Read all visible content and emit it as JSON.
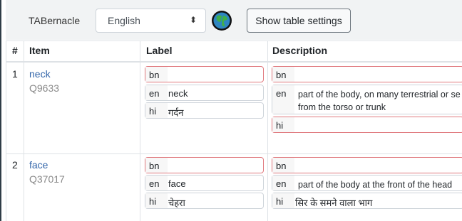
{
  "toolbar": {
    "app_name": "TABernacle",
    "language_select": {
      "value": "English",
      "arrows": "⬍"
    },
    "globe_icon": "globe-icon",
    "show_settings_label": "Show table settings"
  },
  "table": {
    "headers": {
      "num": "#",
      "item": "Item",
      "label": "Label",
      "description": "Description"
    },
    "rows": [
      {
        "num": "1",
        "item_label": "neck",
        "item_id": "Q9633",
        "labels": [
          {
            "lang": "bn",
            "text": ""
          },
          {
            "lang": "en",
            "text": "neck"
          },
          {
            "lang": "hi",
            "text": "गर्दन"
          }
        ],
        "descriptions": [
          {
            "lang": "bn",
            "text": ""
          },
          {
            "lang": "en",
            "line1": "part of the body, on many terrestrial or se",
            "line2": "from the torso or trunk"
          },
          {
            "lang": "hi",
            "text": ""
          }
        ]
      },
      {
        "num": "2",
        "item_label": "face",
        "item_id": "Q37017",
        "labels": [
          {
            "lang": "bn",
            "text": ""
          },
          {
            "lang": "en",
            "text": "face"
          },
          {
            "lang": "hi",
            "text": "चेहरा"
          }
        ],
        "descriptions": [
          {
            "lang": "bn",
            "text": ""
          },
          {
            "lang": "en",
            "text": "part of the body at the front of the head"
          },
          {
            "lang": "hi",
            "text": "सिर के समने वाला भाग"
          }
        ]
      }
    ]
  },
  "colors": {
    "link": "#3366aa",
    "error_border": "#e0797e",
    "toolbar_bg": "#f1f3f4"
  }
}
